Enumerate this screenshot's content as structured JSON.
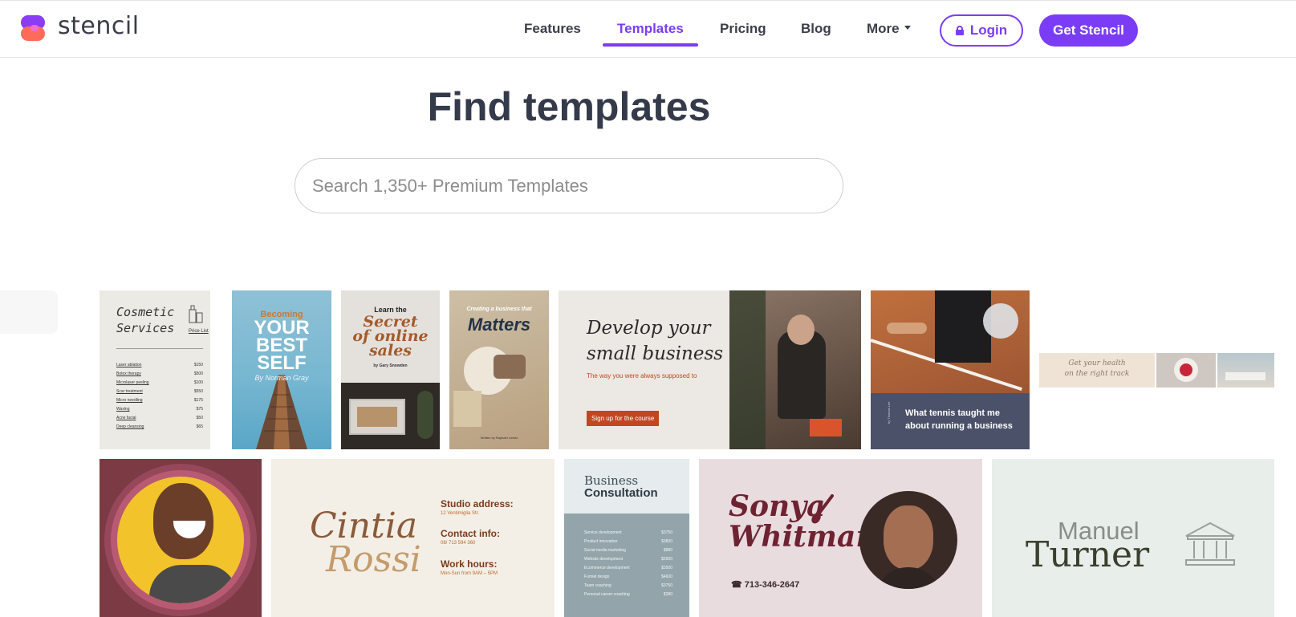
{
  "header": {
    "brand": "stencil",
    "nav": [
      "Features",
      "Templates",
      "Pricing",
      "Blog",
      "More"
    ],
    "login_label": "Login",
    "cta_label": "Get Stencil"
  },
  "main": {
    "title": "Find templates",
    "search_placeholder": "Search 1,350+ Premium Templates"
  },
  "templates": {
    "cosmetic": {
      "title1": "Cosmetic",
      "title2": "Services",
      "price_list": "Price List",
      "services": [
        "Laser ablation",
        "Botox therapy",
        "Microlaser peeling",
        "Scar treatment",
        "Micro needling",
        "Waxing",
        "Acne facial",
        "Deep cleansing"
      ],
      "prices": [
        "$150",
        "$500",
        "$100",
        "$550",
        "$175",
        "$75",
        "$50",
        "$65"
      ]
    },
    "best_self": {
      "line1": "Becoming",
      "line2": "YOUR",
      "line3": "BEST",
      "line4": "SELF",
      "author": "By Norman Gray"
    },
    "online_sales": {
      "line1": "Learn the",
      "line2": "Secret",
      "line3": "of online",
      "line4": "sales",
      "author": "by Gary Snowden"
    },
    "matters": {
      "line1": "Creating a business that",
      "line2": "Matters",
      "author": "Written by Raphael Lewitz"
    },
    "small_business": {
      "line1": "Develop your",
      "line2": "small business",
      "sub": "The way you were always supposed to",
      "button": "Sign up for the course"
    },
    "tennis": {
      "line1": "What tennis taught me",
      "line2": "about running a business",
      "side": "by Thomas Lee"
    },
    "health": {
      "line1": "Get your health",
      "line2": "on the right track"
    },
    "cintia": {
      "name1": "Cintia",
      "name2": "Rossi",
      "studio_label": "Studio address:",
      "studio_value": "12 Ventimiglia Str.",
      "contact_label": "Contact info:",
      "contact_value": "08/ 713 594 360",
      "hours_label": "Work hours:",
      "hours_value": "Mon-Sun from 9AM – 5PM"
    },
    "consultation": {
      "line1": "Business",
      "line2": "Consultation",
      "services": [
        "Service development",
        "Product innovation",
        "Social media marketing",
        "Website development",
        "Ecommerce development",
        "Funnel design",
        "Team coaching",
        "Personal career coaching"
      ],
      "prices": [
        "$3750",
        "$3800",
        "$880",
        "$2500",
        "$3500",
        "$4600",
        "$3750",
        "$380"
      ]
    },
    "sonya": {
      "line1": "Sonya",
      "line2": "Whitman",
      "phone": "713-346-2647"
    },
    "manuel": {
      "line1": "Manuel",
      "line2": "Turner"
    }
  },
  "colors": {
    "accent": "#7a3df5",
    "title_text": "#343a4a"
  }
}
